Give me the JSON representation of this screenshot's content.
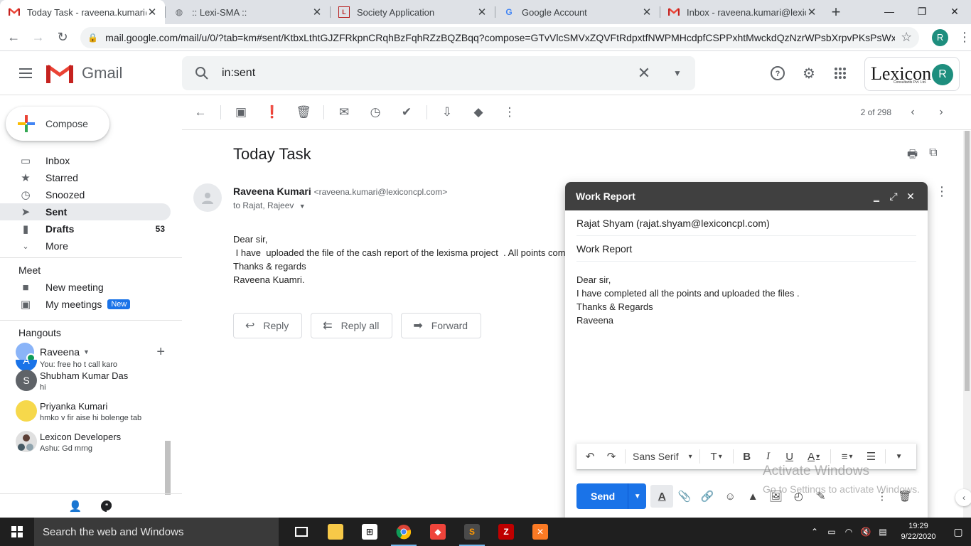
{
  "browser": {
    "tabs": [
      {
        "title": "Today Task - raveena.kumari@l",
        "icon": "gmail-icon",
        "active": true
      },
      {
        "title": ":: Lexi-SMA ::",
        "icon": "globe-icon",
        "active": false
      },
      {
        "title": "Society Application",
        "icon": "lexicon-icon",
        "active": false
      },
      {
        "title": "Google Account",
        "icon": "google-icon",
        "active": false
      },
      {
        "title": "Inbox - raveena.kumari@lexico",
        "icon": "gmail-icon",
        "active": false
      }
    ],
    "url": "mail.google.com/mail/u/0/?tab=km#sent/KtbxLthtGJZFRkpnCRqhBzFqhRZzBQZBqq?compose=GTvVlcSMVxZQVFtRdpxtfNWPMHcdpfCSPPxhtMwckdQzNzrWPsbXrpvPKsPsWxcSj...",
    "profile_initial": "R"
  },
  "gmail": {
    "logo_text": "Gmail",
    "search_value": "in:sent",
    "org_logo": "Lexicon",
    "org_sub": "Consultants Pvt. Ltd.",
    "avatar_initial": "R"
  },
  "sidebar": {
    "compose_label": "Compose",
    "items": [
      {
        "label": "Inbox",
        "count": ""
      },
      {
        "label": "Starred",
        "count": ""
      },
      {
        "label": "Snoozed",
        "count": ""
      },
      {
        "label": "Sent",
        "count": ""
      },
      {
        "label": "Drafts",
        "count": "53"
      },
      {
        "label": "More",
        "count": ""
      }
    ],
    "meet_title": "Meet",
    "meet_items": [
      "New meeting",
      "My meetings"
    ],
    "new_badge": "New",
    "hangouts_title": "Hangouts",
    "hangouts_user": "Raveena",
    "contacts": [
      {
        "name": "",
        "msg": "You: free ho t call karo",
        "initial": "A",
        "color": "#1a73e8"
      },
      {
        "name": "Shubham Kumar Das",
        "msg": "hi",
        "initial": "S",
        "color": "#5f6368"
      },
      {
        "name": "Priyanka Kumari",
        "msg": "hmko v fir aise hi bolenge tab",
        "initial": "",
        "color": "#f6d84b"
      },
      {
        "name": "Lexicon Developers",
        "msg": "Ashu: Gd mrng",
        "initial": "",
        "color": "#9e9e9e"
      }
    ]
  },
  "toolbar": {
    "pager": "2 of 298"
  },
  "email": {
    "subject": "Today Task",
    "sender_name": "Raveena Kumari",
    "sender_email": "<raveena.kumari@lexiconcpl.com>",
    "to_line": "to Rajat, Rajeev",
    "body": [
      "Dear sir,",
      " I have  uploaded the file of the cash report of the lexisma project  . All points com",
      "Thanks & regards",
      "Raveena Kuamri."
    ],
    "reply_label": "Reply",
    "reply_all_label": "Reply all",
    "forward_label": "Forward"
  },
  "compose": {
    "title": "Work Report",
    "to": "Rajat Shyam (rajat.shyam@lexiconcpl.com)",
    "subject": "Work Report",
    "body": [
      "Dear sir,",
      "I have completed all the points and uploaded the files .",
      "Thanks & Regards",
      "Raveena"
    ],
    "font": "Sans Serif",
    "send_label": "Send"
  },
  "watermark": {
    "line1": "Activate Windows",
    "line2": "Go to Settings to activate Windows."
  },
  "taskbar": {
    "search_placeholder": "Search the web and Windows",
    "time": "19:29",
    "date": "9/22/2020"
  }
}
